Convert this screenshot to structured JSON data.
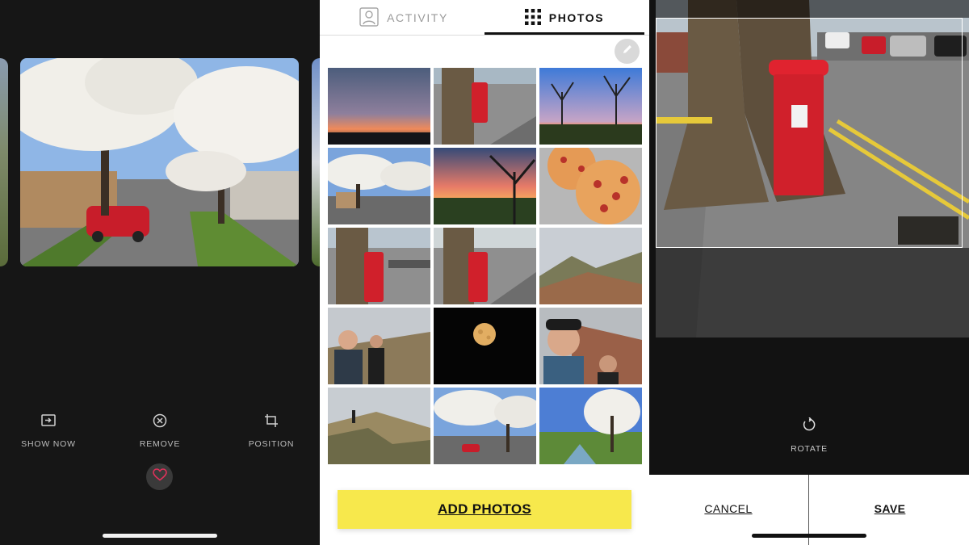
{
  "left_screen": {
    "actions": [
      {
        "label": "SHOW NOW",
        "icon": "show-now-icon"
      },
      {
        "label": "REMOVE",
        "icon": "remove-circle-icon"
      },
      {
        "label": "POSITION",
        "icon": "crop-icon"
      }
    ],
    "favorite_icon": "heart-icon",
    "favorite_color": "#e0315a"
  },
  "middle_screen": {
    "tabs": [
      {
        "label": "ACTIVITY",
        "icon": "person-icon",
        "active": false
      },
      {
        "label": "PHOTOS",
        "icon": "grid-icon",
        "active": true
      }
    ],
    "edit_icon": "pencil-icon",
    "add_button_label": "ADD PHOTOS",
    "add_button_color": "#f7e84c",
    "photos": [
      "sunset-clouds",
      "post-box-street",
      "bare-trees-dusk",
      "blossom-street",
      "sunset-tree",
      "pizzas",
      "post-box-close",
      "post-box-wide",
      "hilltop-hiker",
      "hiking-selfie",
      "full-moon",
      "selfie-couple",
      "hiker-on-rock",
      "blossom-street-2",
      "blossom-stream"
    ]
  },
  "right_screen": {
    "rotate_label": "ROTATE",
    "rotate_icon": "rotate-icon",
    "cancel_label": "CANCEL",
    "save_label": "SAVE"
  }
}
